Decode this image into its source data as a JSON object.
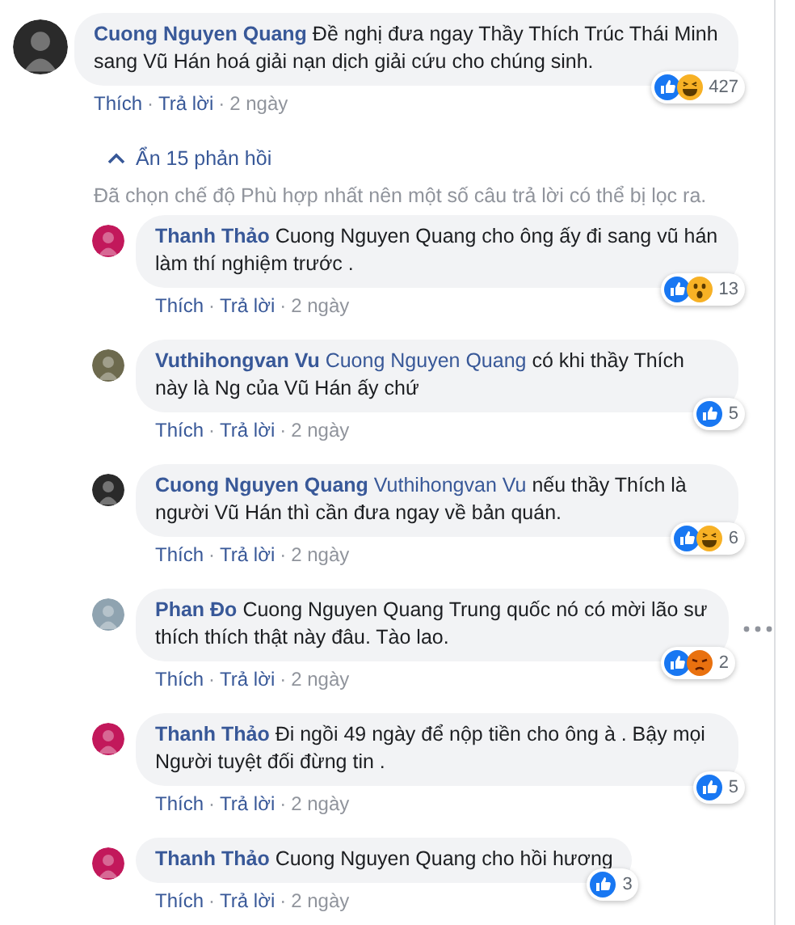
{
  "comment": {
    "author": "Cuong Nguyen Quang",
    "text": "Đề nghị đưa ngay Thầy Thích Trúc Thái Minh sang Vũ Hán hoá giải nạn dịch giải cứu cho chúng sinh.",
    "color": "#2a2a2a",
    "reactions": [
      {
        "kind": "like"
      },
      {
        "kind": "haha"
      }
    ],
    "count": "427",
    "actions": [
      {
        "kind": "link",
        "text": "Thích"
      },
      {
        "kind": "sep",
        "text": "·"
      },
      {
        "kind": "link",
        "text": "Trả lời"
      },
      {
        "kind": "sep",
        "text": "·"
      },
      {
        "kind": "time",
        "text": "2 ngày"
      }
    ]
  },
  "hide_replies": "Ẩn 15 phản hồi",
  "filter_note": "Đã chọn chế độ Phù hợp nhất nên một số câu trả lời có thể bị lọc ra.",
  "replies": [
    {
      "author": "Thanh Thảo",
      "text": "Cuong Nguyen Quang cho ông ấy đi sang vũ hán làm thí nghiệm trước .",
      "color": "#c2185b",
      "reactions": [
        {
          "kind": "like"
        },
        {
          "kind": "wow"
        }
      ],
      "count": "13",
      "menu": false,
      "actions": [
        {
          "kind": "link",
          "text": "Thích"
        },
        {
          "kind": "sep",
          "text": "·"
        },
        {
          "kind": "link",
          "text": "Trả lời"
        },
        {
          "kind": "sep",
          "text": "·"
        },
        {
          "kind": "time",
          "text": "2 ngày"
        }
      ]
    },
    {
      "author": "Vuthihongvan Vu",
      "mention": "Cuong Nguyen Quang",
      "text": "có khi thầy Thích này là Ng của Vũ Hán ấy chứ",
      "color": "#6d6a4e",
      "reactions": [
        {
          "kind": "like"
        }
      ],
      "count": "5",
      "menu": false,
      "actions": [
        {
          "kind": "link",
          "text": "Thích"
        },
        {
          "kind": "sep",
          "text": "·"
        },
        {
          "kind": "link",
          "text": "Trả lời"
        },
        {
          "kind": "sep",
          "text": "·"
        },
        {
          "kind": "time",
          "text": "2 ngày"
        }
      ]
    },
    {
      "author": "Cuong Nguyen Quang",
      "mention": "Vuthihongvan Vu",
      "text": "nếu thầy Thích là người Vũ Hán thì cần đưa ngay về bản quán.",
      "color": "#2a2a2a",
      "reactions": [
        {
          "kind": "like"
        },
        {
          "kind": "haha"
        }
      ],
      "count": "6",
      "menu": false,
      "actions": [
        {
          "kind": "link",
          "text": "Thích"
        },
        {
          "kind": "sep",
          "text": "·"
        },
        {
          "kind": "link",
          "text": "Trả lời"
        },
        {
          "kind": "sep",
          "text": "·"
        },
        {
          "kind": "time",
          "text": "2 ngày"
        }
      ]
    },
    {
      "author": "Phan Đo",
      "text": "Cuong Nguyen Quang Trung quốc nó có mời lão sư thích thích thật này đâu. Tào lao.",
      "color": "#8fa3b0",
      "reactions": [
        {
          "kind": "like"
        },
        {
          "kind": "angry"
        }
      ],
      "count": "2",
      "menu": true,
      "actions": [
        {
          "kind": "link",
          "text": "Thích"
        },
        {
          "kind": "sep",
          "text": "·"
        },
        {
          "kind": "link",
          "text": "Trả lời"
        },
        {
          "kind": "sep",
          "text": "·"
        },
        {
          "kind": "time",
          "text": "2 ngày"
        }
      ]
    },
    {
      "author": "Thanh Thảo",
      "text": "Đi ngồi 49 ngày để nộp tiền cho ông à . Bậy mọi Người tuyệt đối đừng tin .",
      "color": "#c2185b",
      "reactions": [
        {
          "kind": "like"
        }
      ],
      "count": "5",
      "menu": false,
      "actions": [
        {
          "kind": "link",
          "text": "Thích"
        },
        {
          "kind": "sep",
          "text": "·"
        },
        {
          "kind": "link",
          "text": "Trả lời"
        },
        {
          "kind": "sep",
          "text": "·"
        },
        {
          "kind": "time",
          "text": "2 ngày"
        }
      ]
    },
    {
      "author": "Thanh Thảo",
      "text": "Cuong Nguyen Quang cho hồi hương",
      "color": "#c2185b",
      "reactions": [
        {
          "kind": "like"
        }
      ],
      "count": "3",
      "menu": false,
      "actions": [
        {
          "kind": "link",
          "text": "Thích"
        },
        {
          "kind": "sep",
          "text": "·"
        },
        {
          "kind": "link",
          "text": "Trả lời"
        },
        {
          "kind": "sep",
          "text": "·"
        },
        {
          "kind": "time",
          "text": "2 ngày"
        }
      ]
    }
  ]
}
